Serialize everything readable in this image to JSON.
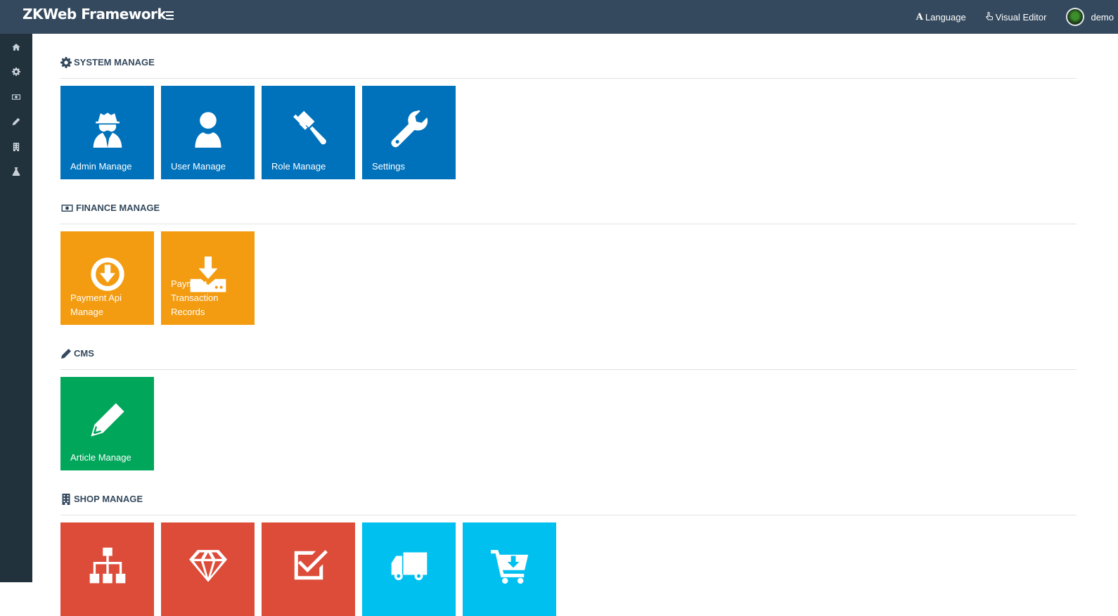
{
  "app": {
    "brand": "ZKWeb Framework"
  },
  "topnav": {
    "language_label": "Language",
    "visual_editor_label": "Visual Editor",
    "user_name": "demo"
  },
  "sidebar": {
    "items": [
      {
        "icon": "home-icon"
      },
      {
        "icon": "gear-icon"
      },
      {
        "icon": "money-icon"
      },
      {
        "icon": "pencil-icon"
      },
      {
        "icon": "building-icon"
      },
      {
        "icon": "flask-icon"
      }
    ]
  },
  "sections": [
    {
      "title": "SYSTEM MANAGE",
      "icon": "gear-icon",
      "tiles": [
        {
          "label": "Admin Manage",
          "icon": "spy-icon",
          "color": "#0072bc"
        },
        {
          "label": "User Manage",
          "icon": "user-icon",
          "color": "#0072bc"
        },
        {
          "label": "Role Manage",
          "icon": "gavel-icon",
          "color": "#0072bc"
        },
        {
          "label": "Settings",
          "icon": "wrench-icon",
          "color": "#0072bc"
        }
      ]
    },
    {
      "title": "FINANCE MANAGE",
      "icon": "money-icon",
      "tiles": [
        {
          "label": "Payment Api Manage",
          "icon": "circle-arrow-down-icon",
          "color": "#f39c12"
        },
        {
          "label": "Payment Transaction Records",
          "icon": "download-tray-icon",
          "color": "#f39c12"
        }
      ]
    },
    {
      "title": "CMS",
      "icon": "pencil-icon",
      "tiles": [
        {
          "label": "Article Manage",
          "icon": "pencil-icon",
          "color": "#00a65a"
        }
      ]
    },
    {
      "title": "SHOP MANAGE",
      "icon": "building-icon",
      "tiles": [
        {
          "label": "",
          "icon": "sitemap-icon",
          "color": "#dd4b39"
        },
        {
          "label": "",
          "icon": "diamond-icon",
          "color": "#dd4b39"
        },
        {
          "label": "",
          "icon": "check-square-icon",
          "color": "#dd4b39"
        },
        {
          "label": "",
          "icon": "truck-icon",
          "color": "#00c0ef"
        },
        {
          "label": "",
          "icon": "cart-download-icon",
          "color": "#00c0ef"
        }
      ]
    }
  ]
}
